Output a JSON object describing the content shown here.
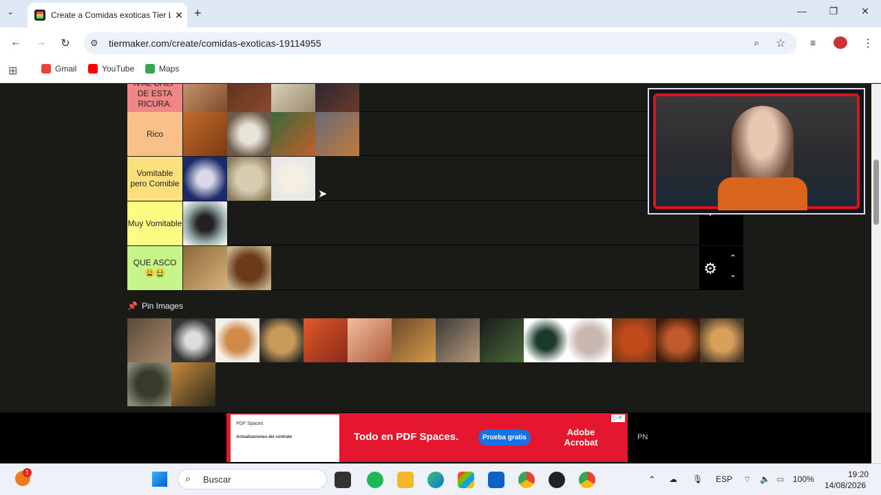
{
  "browser": {
    "tab_title": "Create a Comidas exoticas Tier List",
    "tab_close": "✕",
    "new_tab": "+",
    "url": "tiermaker.com/create/comidas-exoticas-19114955",
    "bookmarks": [
      {
        "label": "Gmail",
        "color": "#ea4335"
      },
      {
        "label": "YouTube",
        "color": "#ff0000"
      },
      {
        "label": "Maps",
        "color": "#34a853"
      }
    ]
  },
  "tiers": [
    {
      "label": "N AL CHEF DE ESTA RICURA.",
      "color": "#f08686",
      "thumbs": 4
    },
    {
      "label": "Rico",
      "color": "#f9c08a",
      "thumbs": 4
    },
    {
      "label": "Vomitable pero Comible",
      "color": "#fbe07e",
      "thumbs": 3
    },
    {
      "label": "Muy Vomitable",
      "color": "#fcfc84",
      "thumbs": 1
    },
    {
      "label": "QUE ASCO 😩🤮",
      "color": "#c8f58a",
      "thumbs": 2
    }
  ],
  "pin_images": {
    "label": "Pin Images",
    "count": 16
  },
  "ad": {
    "brand": "PDF Spaces",
    "headline": "Todo en PDF Spaces.",
    "cta": "Prueba gratis",
    "logo": "Adobe Acrobat",
    "doc_title": "Actualizaciones del contrato",
    "side": "PN"
  },
  "taskbar": {
    "search_placeholder": "Buscar",
    "lang": "ESP",
    "battery": "100%",
    "time": "19:20",
    "date": "14/08/2026",
    "notification_count": "1"
  },
  "colors": {
    "page_bg": "#1a1a17",
    "ad_red": "#e5172f",
    "cta_blue": "#1473e6",
    "webcam_frame": "#e0101e"
  }
}
